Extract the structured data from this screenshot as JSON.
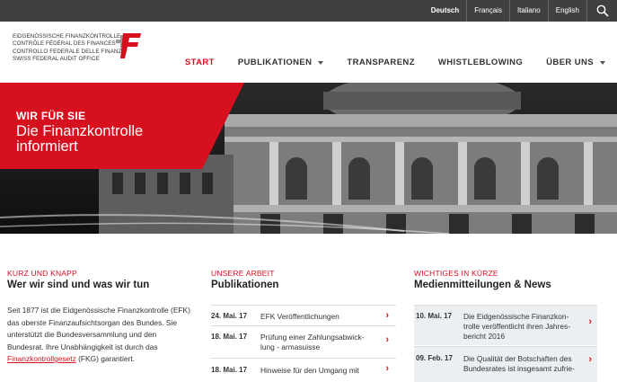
{
  "languages": [
    "Deutsch",
    "Français",
    "Italiano",
    "English"
  ],
  "logo": {
    "lines": [
      "Eidgenössische Finanzkontrolle",
      "Contrôle fédéral des finances",
      "Controllo federale delle finanze",
      "Swiss Federal Audit Office"
    ]
  },
  "nav": {
    "items": [
      "START",
      "PUBLIKATIONEN",
      "TRANSPARENZ",
      "WHISTLEBLOWING",
      "ÜBER UNS"
    ]
  },
  "hero": {
    "kicker": "WIR FÜR SIE",
    "title_line1": "Die Finanzkontrolle",
    "title_line2": "informiert"
  },
  "col1": {
    "kicker": "KURZ UND KNAPP",
    "title": "Wer wir sind und was wir tun",
    "text_before_link": "Seit 1877 ist die Eidgenössische Finanzkontrolle (EFK) das oberste Finanzaufsichtsorgan des Bundes. Sie unterstützt die Bundesversammlung und den Bundesrat. Ihre Unabhängigkeit ist durch das ",
    "link": "Finanzkontrollgesetz",
    "text_after_link": " (FKG) garantiert."
  },
  "col2": {
    "kicker": "UNSERE ARBEIT",
    "title": "Publikationen",
    "rows": [
      {
        "date": "24. Mai. 17",
        "text": "EFK Veröffentlichungen"
      },
      {
        "date": "18. Mai. 17",
        "text": "Prüfung einer Zahlungsabwick-lung - armasuisse"
      },
      {
        "date": "18. Mai. 17",
        "text": "Hinweise für den Umgang mit"
      }
    ]
  },
  "col3": {
    "kicker": "WICHTIGES IN KÜRZE",
    "title": "Medienmitteilungen & News",
    "rows": [
      {
        "date": "10. Mai. 17",
        "text": "Die Eidgenössische Finanzkon-trolle veröffentlicht ihren Jahres-bericht 2016"
      },
      {
        "date": "09. Feb. 17",
        "text": "Die Qualität der Botschaften des Bundesrates ist insgesamt zufrie-"
      }
    ]
  },
  "colors": {
    "brand_red": "#d7101f",
    "topbar": "#404040"
  }
}
